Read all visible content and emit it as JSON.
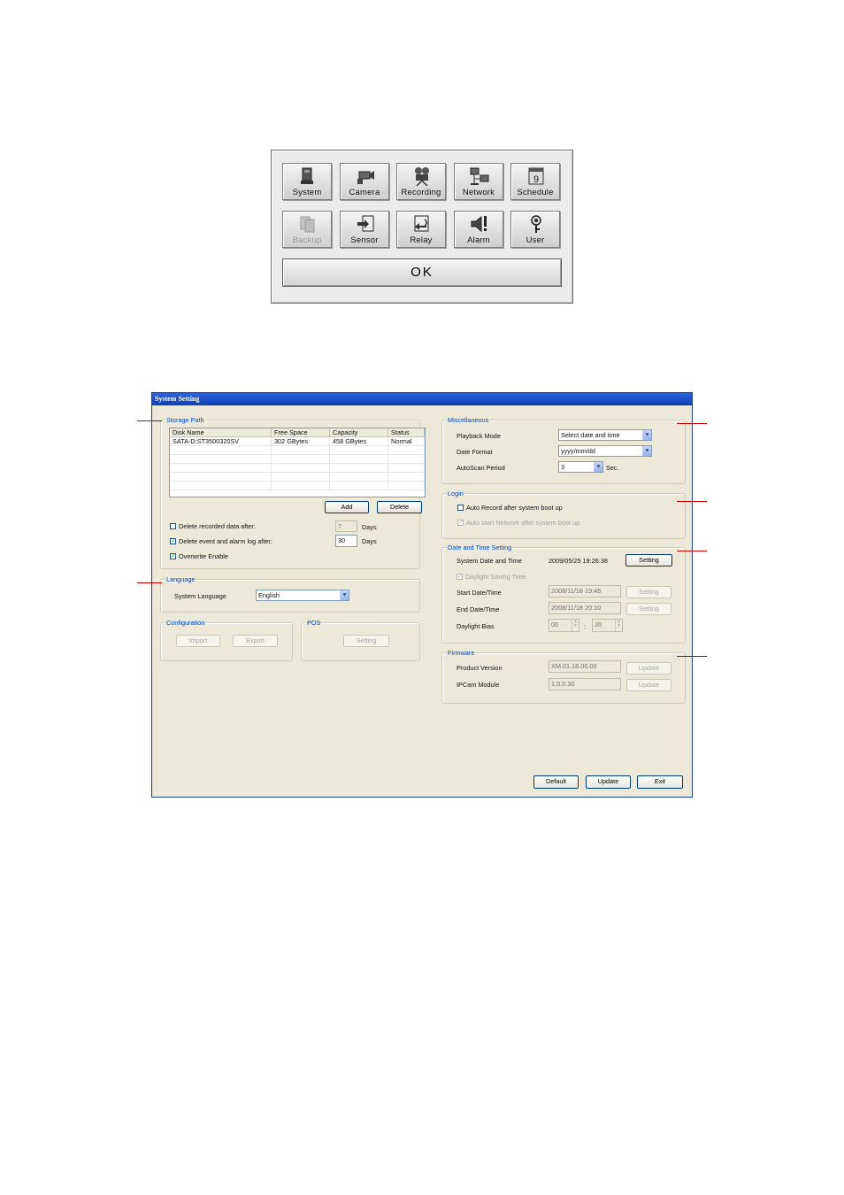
{
  "menu": {
    "buttons": [
      {
        "label": "System",
        "icon": "system-icon"
      },
      {
        "label": "Camera",
        "icon": "camera-icon"
      },
      {
        "label": "Recording",
        "icon": "recording-icon"
      },
      {
        "label": "Network",
        "icon": "network-icon"
      },
      {
        "label": "Schedule",
        "icon": "schedule-icon"
      },
      {
        "label": "Backup",
        "icon": "backup-icon",
        "disabled": true
      },
      {
        "label": "Sensor",
        "icon": "sensor-icon"
      },
      {
        "label": "Relay",
        "icon": "relay-icon"
      },
      {
        "label": "Alarm",
        "icon": "alarm-icon"
      },
      {
        "label": "User",
        "icon": "user-icon"
      }
    ],
    "ok_label": "OK",
    "schedule_digit": "9"
  },
  "window": {
    "title": "System Setting",
    "storage": {
      "title": "Storage Path",
      "columns": [
        "Disk Name",
        "Free Space",
        "Capacity",
        "Status"
      ],
      "rows": [
        [
          "SATA-D:ST3500320SV",
          "302 GBytes",
          "458 GBytes",
          "Normal"
        ]
      ],
      "add_label": "Add",
      "delete_label": "Delete",
      "delete_recorded_label": "Delete recorded data after:",
      "delete_recorded_checked": false,
      "delete_recorded_days": "7",
      "delete_log_label": "Delete event and alarm log after:",
      "delete_log_checked": true,
      "delete_log_days": "30",
      "days_label": "Days",
      "overwrite_label": "Overwrite Enable",
      "overwrite_checked": true
    },
    "language": {
      "title": "Language",
      "system_language_label": "System Language",
      "system_language_value": "English"
    },
    "configuration": {
      "title": "Configuration",
      "import_label": "Import",
      "export_label": "Export"
    },
    "pos": {
      "title": "POS",
      "setting_label": "Setting"
    },
    "misc": {
      "title": "Miscellaneous",
      "playback_mode_label": "Playback Mode",
      "playback_mode_value": "Select date and time",
      "date_format_label": "Date Format",
      "date_format_value": "yyyy/mm/dd",
      "autoscan_label": "AutoScan Period",
      "autoscan_value": "3",
      "sec_label": "Sec."
    },
    "login": {
      "title": "Login",
      "auto_record_label": "Auto Record after system boot up",
      "auto_record_checked": false,
      "auto_network_label": "Auto start Network after system boot up",
      "auto_network_checked": true
    },
    "datetime": {
      "title": "Date and Time Setting",
      "system_label": "System Date and Time",
      "system_value": "2009/05/25 19:26:38",
      "setting_label": "Setting",
      "dst_label": "Daylight Saving Time",
      "dst_checked": true,
      "start_label": "Start Date/Time",
      "start_value": "2008/11/18 19:45",
      "end_label": "End Date/Time",
      "end_value": "2008/11/18 20:10",
      "bias_label": "Daylight Bias",
      "bias_hours": "00",
      "bias_colon": ":",
      "bias_minutes": "20"
    },
    "firmware": {
      "title": "Firmware",
      "product_label": "Product Version",
      "product_value": "XM.01.18.00.00",
      "ipcam_label": "IPCam Module",
      "ipcam_value": "1.0.0.30",
      "update_label": "Update"
    },
    "footer": {
      "default_label": "Default",
      "update_label": "Update",
      "exit_label": "Exit"
    }
  },
  "colors": {
    "title_bar": "#0a3fb9",
    "group_title": "#0046d5",
    "callout": "#c00000",
    "window_bg": "#ece9d8"
  }
}
